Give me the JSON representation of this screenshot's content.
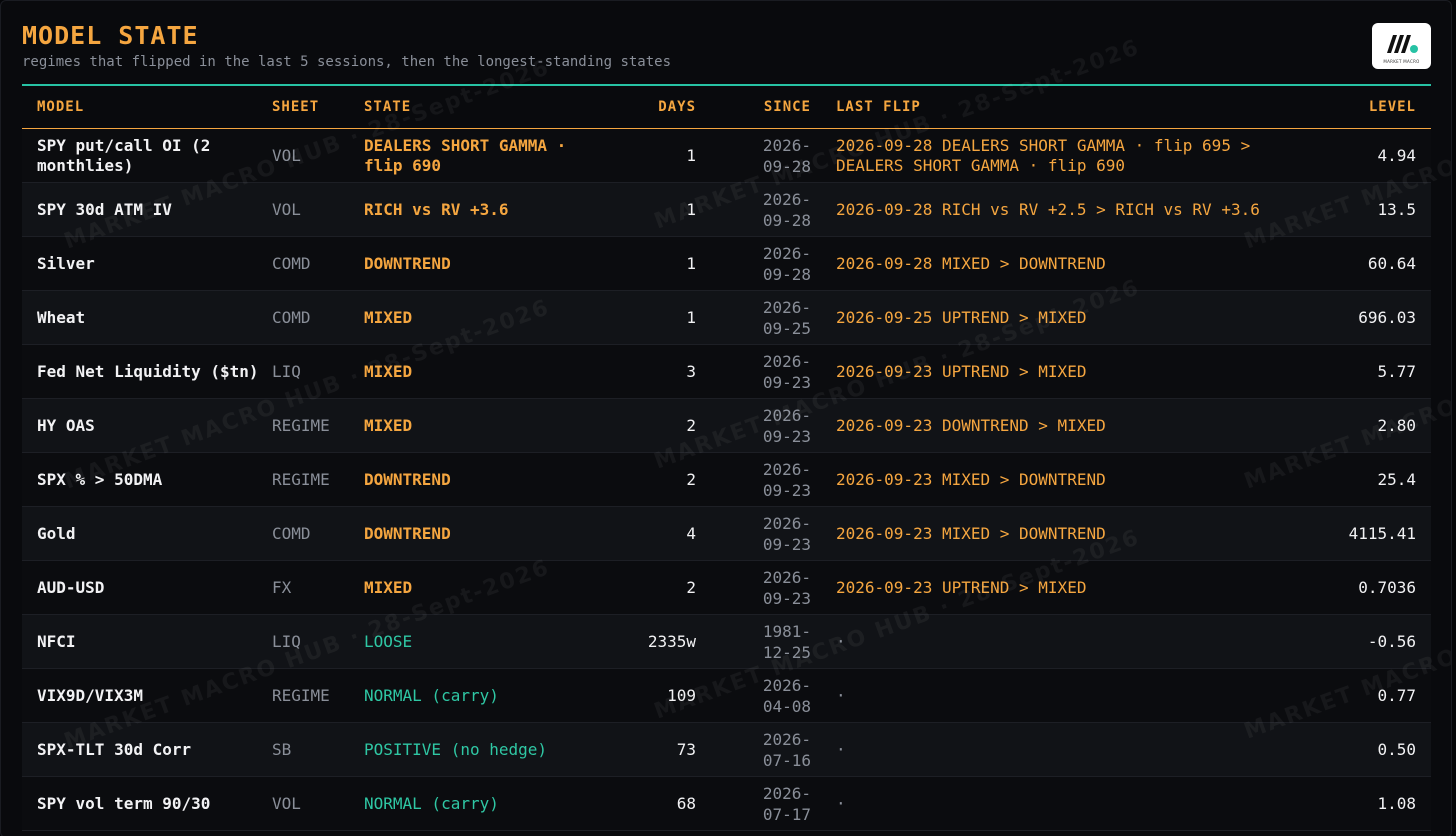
{
  "header": {
    "title": "MODEL STATE",
    "subtitle": "regimes that flipped in the last 5 sessions, then the longest-standing states"
  },
  "logo": {
    "name": "market-macro-logo",
    "text": "MARKET MACRO"
  },
  "watermark": {
    "text": "MARKET MACRO HUB · 28-Sept-2026"
  },
  "colors": {
    "accent": "#f5a640",
    "teal": "#27c2a4",
    "muted": "#8a8f99"
  },
  "table": {
    "columns": {
      "model": "MODEL",
      "sheet": "SHEET",
      "state": "STATE",
      "days": "DAYS",
      "since": "SINCE",
      "last_flip": "LAST FLIP",
      "level": "LEVEL"
    },
    "rows": [
      {
        "model": "SPY put/call OI (2 monthlies)",
        "sheet": "VOL",
        "state": "DEALERS SHORT GAMMA · flip 690",
        "tone": "hot",
        "days": "1",
        "since_y": "2026-",
        "since_md": "09-28",
        "last_flip": "2026-09-28 DEALERS SHORT GAMMA · flip 695 > DEALERS SHORT GAMMA · flip 690",
        "level": "4.94"
      },
      {
        "model": "SPY 30d ATM IV",
        "sheet": "VOL",
        "state": "RICH vs RV +3.6",
        "tone": "hot",
        "days": "1",
        "since_y": "2026-",
        "since_md": "09-28",
        "last_flip": "2026-09-28 RICH vs RV +2.5 > RICH vs RV +3.6",
        "level": "13.5"
      },
      {
        "model": "Silver",
        "sheet": "COMD",
        "state": "DOWNTREND",
        "tone": "hot",
        "days": "1",
        "since_y": "2026-",
        "since_md": "09-28",
        "last_flip": "2026-09-28 MIXED > DOWNTREND",
        "level": "60.64"
      },
      {
        "model": "Wheat",
        "sheet": "COMD",
        "state": "MIXED",
        "tone": "hot",
        "days": "1",
        "since_y": "2026-",
        "since_md": "09-25",
        "last_flip": "2026-09-25 UPTREND > MIXED",
        "level": "696.03"
      },
      {
        "model": "Fed Net Liquidity ($tn)",
        "sheet": "LIQ",
        "state": "MIXED",
        "tone": "hot",
        "days": "3",
        "since_y": "2026-",
        "since_md": "09-23",
        "last_flip": "2026-09-23 UPTREND > MIXED",
        "level": "5.77"
      },
      {
        "model": "HY OAS",
        "sheet": "REGIME",
        "state": "MIXED",
        "tone": "hot",
        "days": "2",
        "since_y": "2026-",
        "since_md": "09-23",
        "last_flip": "2026-09-23 DOWNTREND > MIXED",
        "level": "2.80"
      },
      {
        "model": "SPX % > 50DMA",
        "sheet": "REGIME",
        "state": "DOWNTREND",
        "tone": "hot",
        "days": "2",
        "since_y": "2026-",
        "since_md": "09-23",
        "last_flip": "2026-09-23 MIXED > DOWNTREND",
        "level": "25.4"
      },
      {
        "model": "Gold",
        "sheet": "COMD",
        "state": "DOWNTREND",
        "tone": "hot",
        "days": "4",
        "since_y": "2026-",
        "since_md": "09-23",
        "last_flip": "2026-09-23 MIXED > DOWNTREND",
        "level": "4115.41"
      },
      {
        "model": "AUD-USD",
        "sheet": "FX",
        "state": "MIXED",
        "tone": "hot",
        "days": "2",
        "since_y": "2026-",
        "since_md": "09-23",
        "last_flip": "2026-09-23 UPTREND > MIXED",
        "level": "0.7036"
      },
      {
        "model": "NFCI",
        "sheet": "LIQ",
        "state": "LOOSE",
        "tone": "cool",
        "days": "2335w",
        "since_y": "1981-",
        "since_md": "12-25",
        "last_flip": "·",
        "level": "-0.56"
      },
      {
        "model": "VIX9D/VIX3M",
        "sheet": "REGIME",
        "state": "NORMAL (carry)",
        "tone": "cool",
        "days": "109",
        "since_y": "2026-",
        "since_md": "04-08",
        "last_flip": "·",
        "level": "0.77"
      },
      {
        "model": "SPX-TLT 30d Corr",
        "sheet": "SB",
        "state": "POSITIVE (no hedge)",
        "tone": "cool",
        "days": "73",
        "since_y": "2026-",
        "since_md": "07-16",
        "last_flip": "·",
        "level": "0.50"
      },
      {
        "model": "SPY vol term 90/30",
        "sheet": "VOL",
        "state": "NORMAL (carry)",
        "tone": "cool",
        "days": "68",
        "since_y": "2026-",
        "since_md": "07-17",
        "last_flip": "·",
        "level": "1.08"
      }
    ]
  }
}
